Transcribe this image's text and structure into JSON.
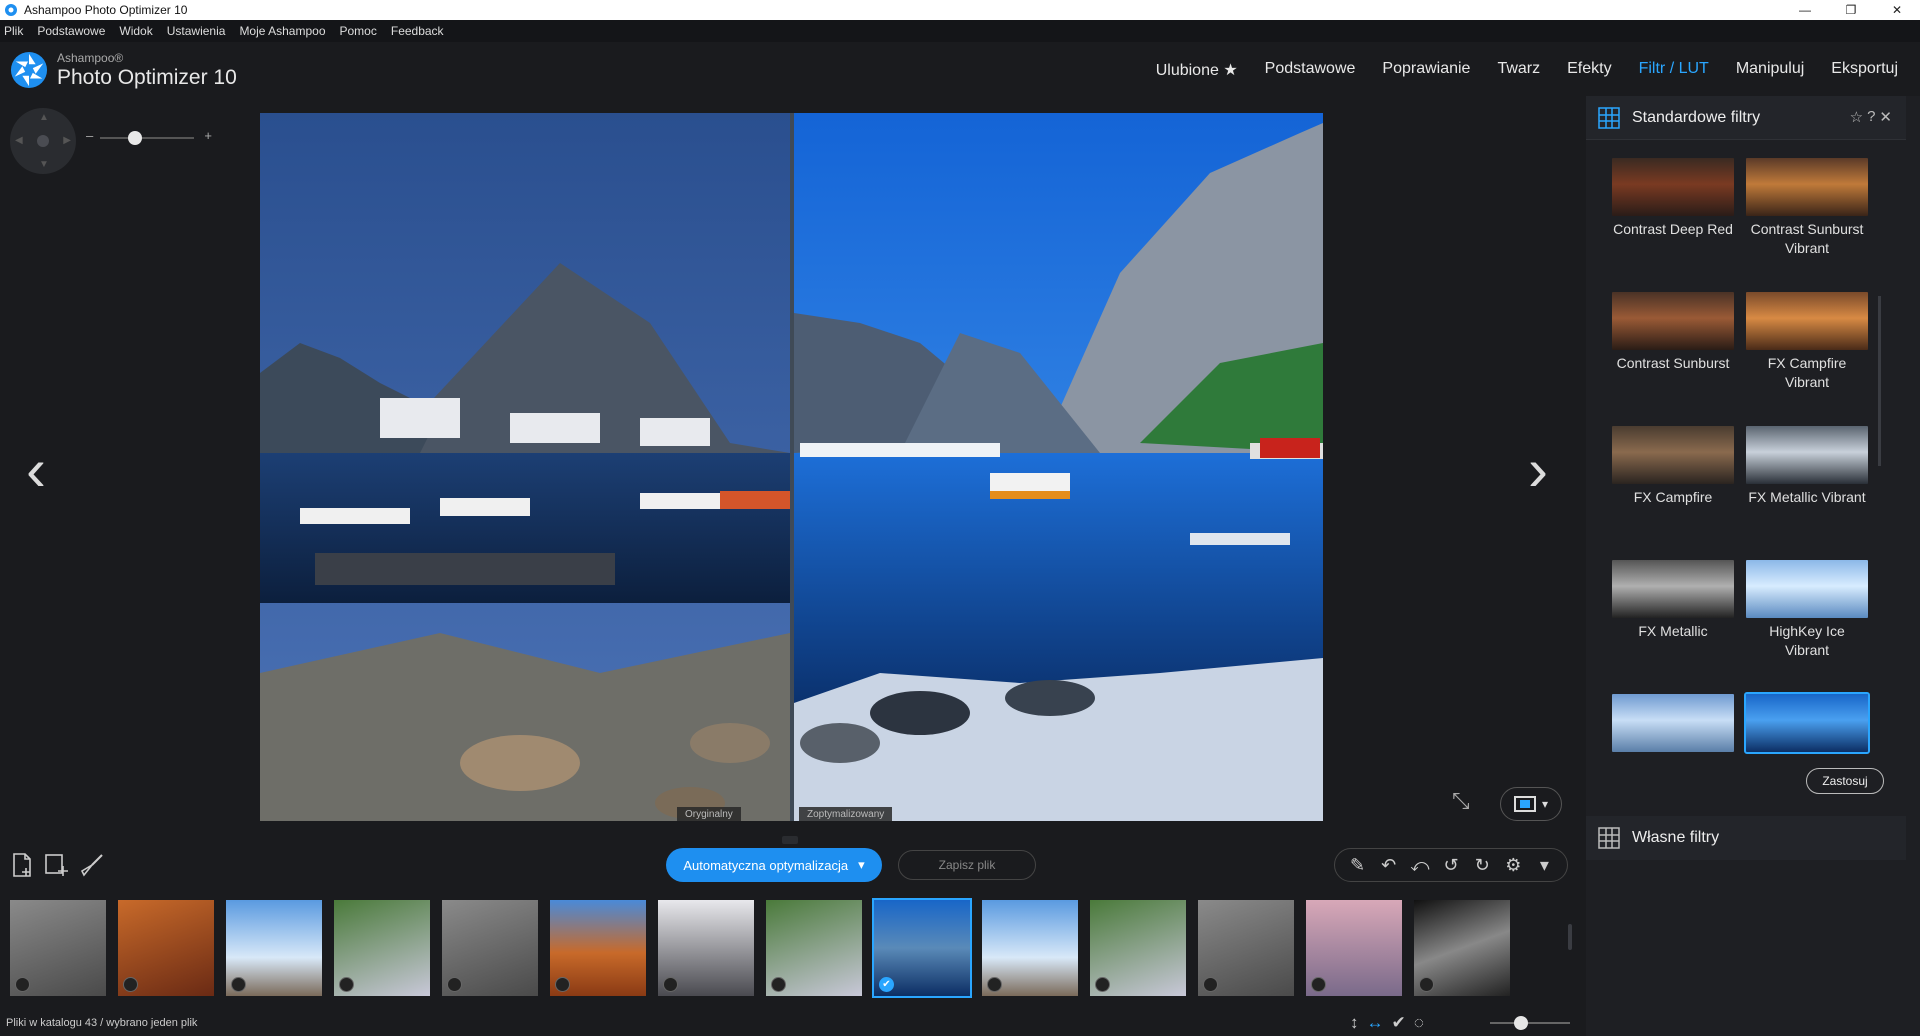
{
  "window": {
    "title": "Ashampoo Photo Optimizer 10",
    "controls": {
      "minimize": "—",
      "restore": "❐",
      "close": "✕"
    }
  },
  "menu": [
    "Plik",
    "Podstawowe",
    "Widok",
    "Ustawienia",
    "Moje Ashampoo",
    "Pomoc",
    "Feedback"
  ],
  "brand": {
    "vendor": "Ashampoo®",
    "product": "Photo Optimizer 10"
  },
  "topnav": {
    "items": [
      "Ulubione ★",
      "Podstawowe",
      "Poprawianie",
      "Twarz",
      "Efekty",
      "Filtr / LUT",
      "Manipuluj",
      "Eksportuj"
    ],
    "active_index": 5,
    "accent_color": "#2aa6ff"
  },
  "zoom": {
    "minus": "–",
    "plus": "+",
    "level": 0.35
  },
  "viewer": {
    "prev_arrow": "‹",
    "next_arrow": "›",
    "label_original": "Oryginalny",
    "label_optimized": "Zoptymalizowany"
  },
  "filters_panel": {
    "title": "Standardowe filtry",
    "icons": [
      "star-outline-icon",
      "help-icon",
      "close-circle-icon"
    ],
    "icon_glyphs": [
      "☆",
      "?",
      "✕"
    ],
    "items": [
      {
        "label": "Contrast Deep Red",
        "tone": "warm-dark"
      },
      {
        "label": "Contrast Sunburst Vibrant",
        "tone": "warm"
      },
      {
        "label": "Contrast Sunburst",
        "tone": "warm-brown"
      },
      {
        "label": "FX Campfire Vibrant",
        "tone": "orange"
      },
      {
        "label": "FX Campfire",
        "tone": "sepia"
      },
      {
        "label": "FX Metallic Vibrant",
        "tone": "cool-grey"
      },
      {
        "label": "FX Metallic",
        "tone": "grey"
      },
      {
        "label": "HighKey Ice Vibrant",
        "tone": "ice"
      },
      {
        "label": "",
        "tone": "ice-light"
      },
      {
        "label": "",
        "tone": "blue-selected"
      }
    ],
    "selected_index": 9,
    "apply_label": "Zastosuj"
  },
  "own_filters": {
    "title": "Własne filtry"
  },
  "toolbar": {
    "auto_optimize_label": "Automatyczna optymalizacja",
    "dropdown_glyph": "▾",
    "save_label": "Zapisz plik"
  },
  "filmstrip": {
    "items": [
      {
        "name": "route-66",
        "tone": "grey"
      },
      {
        "name": "horseshoe-bend",
        "tone": "orange"
      },
      {
        "name": "mailboxes",
        "tone": "sky"
      },
      {
        "name": "flowers-girl",
        "tone": "green"
      },
      {
        "name": "monkeys",
        "tone": "grey"
      },
      {
        "name": "monument-valley",
        "tone": "desert"
      },
      {
        "name": "horse-street",
        "tone": "white"
      },
      {
        "name": "path-trees",
        "tone": "green"
      },
      {
        "name": "fjord",
        "tone": "blue"
      },
      {
        "name": "santorini",
        "tone": "sky"
      },
      {
        "name": "old-truck",
        "tone": "green"
      },
      {
        "name": "havana-street",
        "tone": "grey"
      },
      {
        "name": "palms-sunset",
        "tone": "pink"
      },
      {
        "name": "bw-doorway",
        "tone": "bw"
      }
    ],
    "selected_index": 8,
    "check_glyph": "✔"
  },
  "status": {
    "text": "Pliki w katalogu 43 / wybrano jeden plik"
  }
}
